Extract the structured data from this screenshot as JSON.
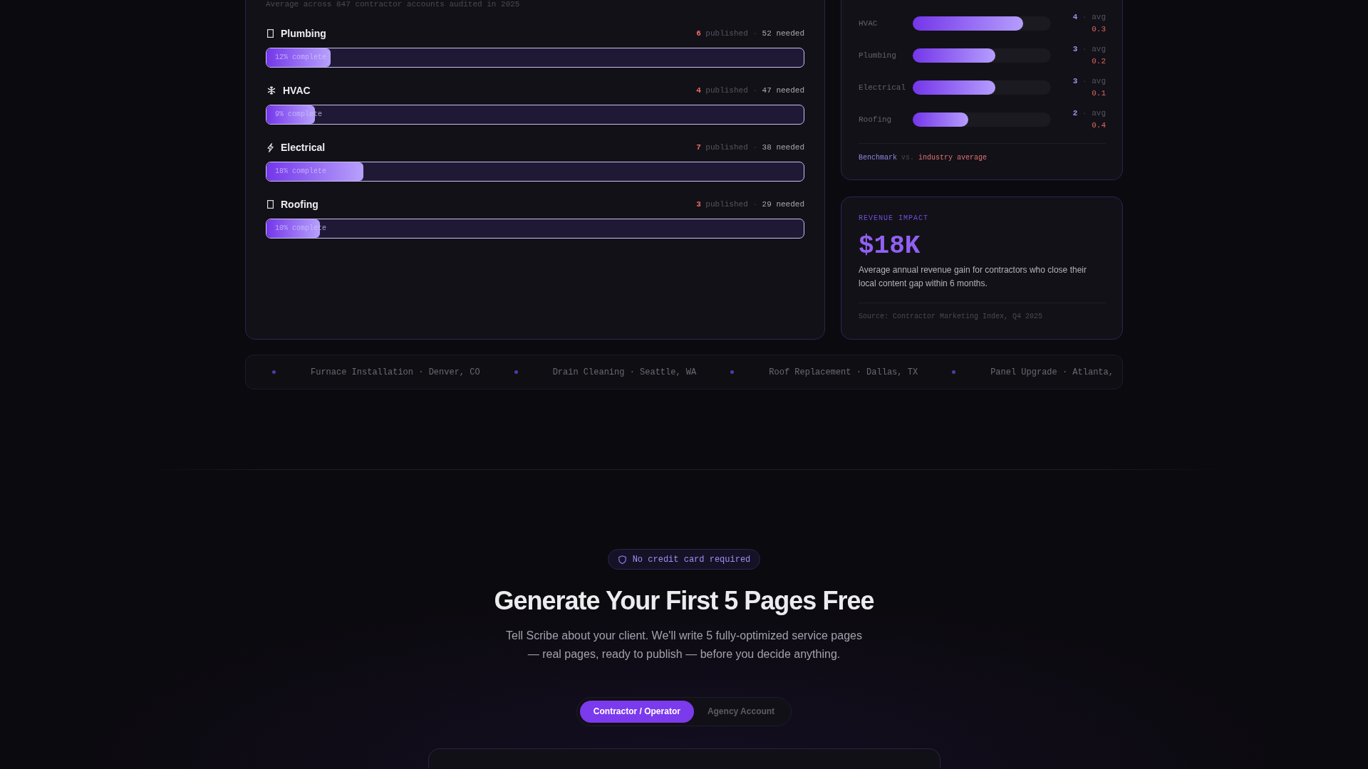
{
  "coverage": {
    "subtitle": "Average across 847 contractor accounts audited in 2025",
    "rows": [
      {
        "name": "Plumbing",
        "published": "6",
        "published_label": "published",
        "separator": "·",
        "needed": "52 needed",
        "level": 0.12,
        "progress_label": "12% complete"
      },
      {
        "name": "HVAC",
        "published": "4",
        "published_label": "published",
        "separator": "·",
        "needed": "47 needed",
        "level": 0.09,
        "progress_label": "9% complete"
      },
      {
        "name": "Electrical",
        "published": "7",
        "published_label": "published",
        "separator": "·",
        "needed": "38 needed",
        "level": 0.18,
        "progress_label": "18% complete"
      },
      {
        "name": "Roofing",
        "published": "3",
        "published_label": "published",
        "separator": "·",
        "needed": "29 needed",
        "level": 0.1,
        "progress_label": "10% complete"
      }
    ]
  },
  "benchmark": {
    "rows": [
      {
        "label": "HVAC",
        "level": 0.8,
        "score": "4",
        "separator": "·",
        "avg_label": "avg",
        "avg_value": "0.3"
      },
      {
        "label": "Plumbing",
        "level": 0.6,
        "score": "3",
        "separator": "·",
        "avg_label": "avg",
        "avg_value": "0.2"
      },
      {
        "label": "Electrical",
        "level": 0.6,
        "score": "3",
        "separator": "·",
        "avg_label": "avg",
        "avg_value": "0.1"
      },
      {
        "label": "Roofing",
        "level": 0.4,
        "score": "2",
        "separator": "·",
        "avg_label": "avg",
        "avg_value": "0.4"
      }
    ],
    "legend": {
      "benchmark": "Benchmark",
      "joiner": "vs.",
      "industry": "industry average"
    }
  },
  "revenue_impact": {
    "eyebrow": "REVENUE IMPACT",
    "value": "$18K",
    "description": "Average annual revenue gain for contractors who close their local content gap within 6 months.",
    "source": "Source: Contractor Marketing Index, Q4 2025"
  },
  "ticker": {
    "items": [
      "Furnace Installation · Denver, CO",
      "Drain Cleaning · Seattle, WA",
      "Roof Replacement · Dallas, TX",
      "Panel Upgrade · Atlanta,"
    ]
  },
  "cta": {
    "badge": "No credit card required",
    "title": "Generate Your First 5 Pages Free",
    "description": "Tell Scribe about your client. We'll write 5 fully-optimized service pages — real pages, ready to publish — before you decide anything.",
    "account_toggle": [
      {
        "label": "Contractor / Operator",
        "selected": true
      },
      {
        "label": "Agency Account",
        "selected": false
      }
    ]
  }
}
